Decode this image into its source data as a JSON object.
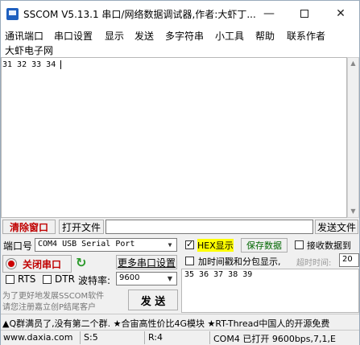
{
  "window": {
    "title": "SSCOM V5.13.1 串口/网络数据调试器,作者:大虾丁..."
  },
  "menu": [
    "通讯端口",
    "串口设置",
    "显示",
    "发送",
    "多字符串",
    "小工具",
    "帮助",
    "联系作者",
    "大虾电子网"
  ],
  "receive": {
    "text": "31 32 33 34 "
  },
  "toolbar": {
    "clear_label": "清除窗口",
    "open_file_label": "打开文件",
    "file_path": "",
    "send_file_label": "发送文件"
  },
  "port": {
    "port_label": "端口号",
    "port_value": "COM4 USB Serial Port",
    "close_port_label": "关闭串口",
    "more_settings_label": "更多串口设置",
    "rts_label": "RTS",
    "dtr_label": "DTR",
    "baud_label": "波特率:",
    "baud_value": "9600"
  },
  "send_panel": {
    "hex_display_label": "HEX显示",
    "save_data_label": "保存数据",
    "recv_to_file_label": "接收数据到",
    "timestamp_label": "加时间戳和分包显示,",
    "timeout_label": "超时时间:",
    "timeout_value": "20",
    "send_text": "35 36 37 38 39",
    "send_label": "发  送"
  },
  "promo": {
    "line1": "为了更好地发展SSCOM软件",
    "line2": "请您注册嘉立创P结尾客户"
  },
  "ticker": "▲Q群满员了,没有第二个群. ★合宙高性价比4G模块 ★RT-Thread中国人的开源免费",
  "status": {
    "website": "www.daxia.com",
    "s": "S:5",
    "r": "R:4",
    "port_state": "COM4 已打开  9600bps,7,1,E"
  },
  "colors": {
    "clear_text": "#c00000",
    "close_port_text": "#c00000",
    "save_data_text": "#006600",
    "hex_highlight": "#ffff00",
    "refresh_green": "#2a9a2a",
    "close_dot": "#cc0000"
  }
}
